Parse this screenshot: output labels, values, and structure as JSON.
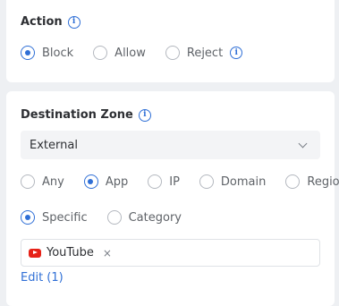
{
  "action": {
    "title": "Action",
    "options": [
      {
        "label": "Block",
        "checked": true
      },
      {
        "label": "Allow",
        "checked": false
      },
      {
        "label": "Reject",
        "checked": false
      }
    ]
  },
  "destination": {
    "title": "Destination Zone",
    "zone_value": "External",
    "type_options": [
      {
        "label": "Any",
        "checked": false
      },
      {
        "label": "App",
        "checked": true
      },
      {
        "label": "IP",
        "checked": false
      },
      {
        "label": "Domain",
        "checked": false
      },
      {
        "label": "Region",
        "checked": false
      }
    ],
    "scope_options": [
      {
        "label": "Specific",
        "checked": true
      },
      {
        "label": "Category",
        "checked": false
      }
    ],
    "selected_tag": "YouTube",
    "tag_remove": "×",
    "edit_link": "Edit (1)"
  },
  "colors": {
    "accent": "#2f6fd6",
    "youtube": "#e62117"
  }
}
